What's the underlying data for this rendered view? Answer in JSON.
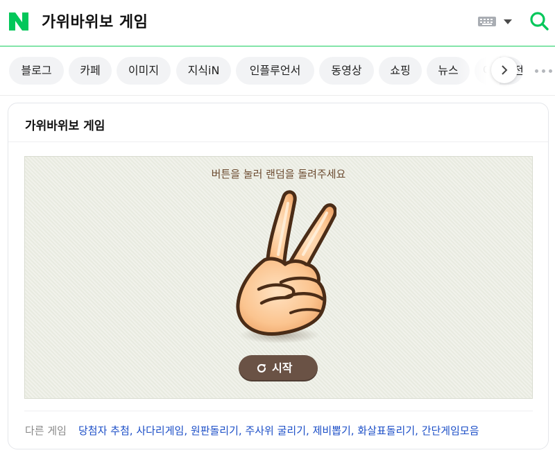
{
  "header": {
    "logo": "N",
    "query": "가위바위보 게임",
    "keyboard_icon": "keyboard-icon",
    "search_icon": "search-icon",
    "accent_color": "#19ce60"
  },
  "tabs": [
    {
      "label": "블로그"
    },
    {
      "label": "카페"
    },
    {
      "label": "이미지"
    },
    {
      "label": "지식iN"
    },
    {
      "label": "인플루언서"
    },
    {
      "label": "동영상"
    },
    {
      "label": "쇼핑"
    },
    {
      "label": "뉴스"
    },
    {
      "label": "어학사전"
    }
  ],
  "card": {
    "title": "가위바위보 게임",
    "instruction": "버튼을 눌러 랜덤을 돌려주세요",
    "hand_icon": "victory-hand-scissors",
    "start_label": "시작",
    "start_icon": "refresh-icon",
    "other_games_label": "다른 게임",
    "other_games": [
      "당첨자 추첨",
      "사다리게임",
      "원판돌리기",
      "주사위 굴리기",
      "제비뽑기",
      "화살표돌리기",
      "간단게임모음"
    ]
  }
}
